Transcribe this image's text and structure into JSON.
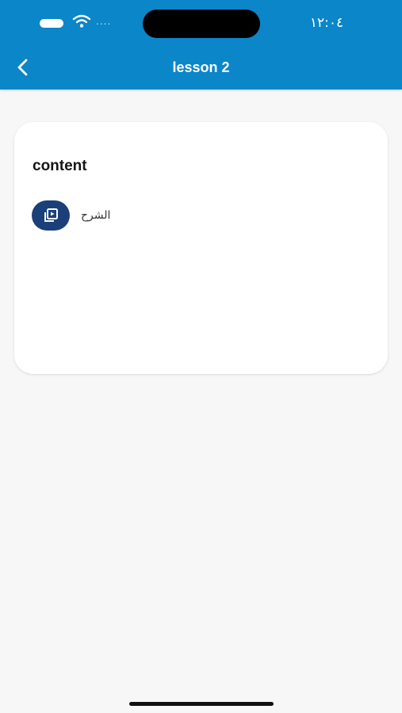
{
  "status_bar": {
    "time": "١٢:٠٤",
    "signal_icon": "signal-dots-icon",
    "wifi_icon": "wifi-icon",
    "battery_icon": "battery-icon"
  },
  "nav": {
    "title": "lesson 2",
    "back_icon": "chevron-left-icon"
  },
  "content_card": {
    "heading": "content",
    "items": [
      {
        "label": "الشرح",
        "icon": "video-library-icon"
      }
    ]
  },
  "colors": {
    "header": "#0a86c9",
    "background": "#f7f7f7",
    "card": "#ffffff",
    "item_icon_bg": "#1b3f79"
  }
}
